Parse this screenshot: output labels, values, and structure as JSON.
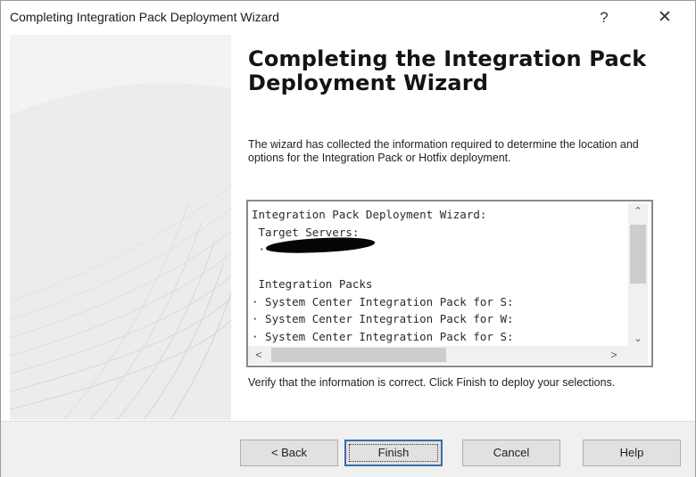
{
  "window": {
    "title": "Completing Integration Pack Deployment Wizard",
    "help_glyph": "?",
    "close_glyph": "✕"
  },
  "main": {
    "heading": "Completing the Integration Pack Deployment Wizard",
    "intro": "The wizard has collected the information required to determine the location and options for the Integration Pack or Hotfix deployment.",
    "verify": "Verify that the information is correct.  Click Finish to deploy your selections."
  },
  "summary": {
    "lines": [
      "Integration Pack Deployment Wizard:",
      " Target Servers:",
      " ·",
      "",
      " Integration Packs",
      "· System Center Integration Pack for S:",
      "· System Center Integration Pack for W:",
      "· System Center Integration Pack for S:"
    ]
  },
  "scroll": {
    "up": "⌃",
    "down": "⌄",
    "left": "<",
    "right": ">"
  },
  "buttons": {
    "back": "< Back",
    "finish": "Finish",
    "cancel": "Cancel",
    "help": "Help"
  }
}
